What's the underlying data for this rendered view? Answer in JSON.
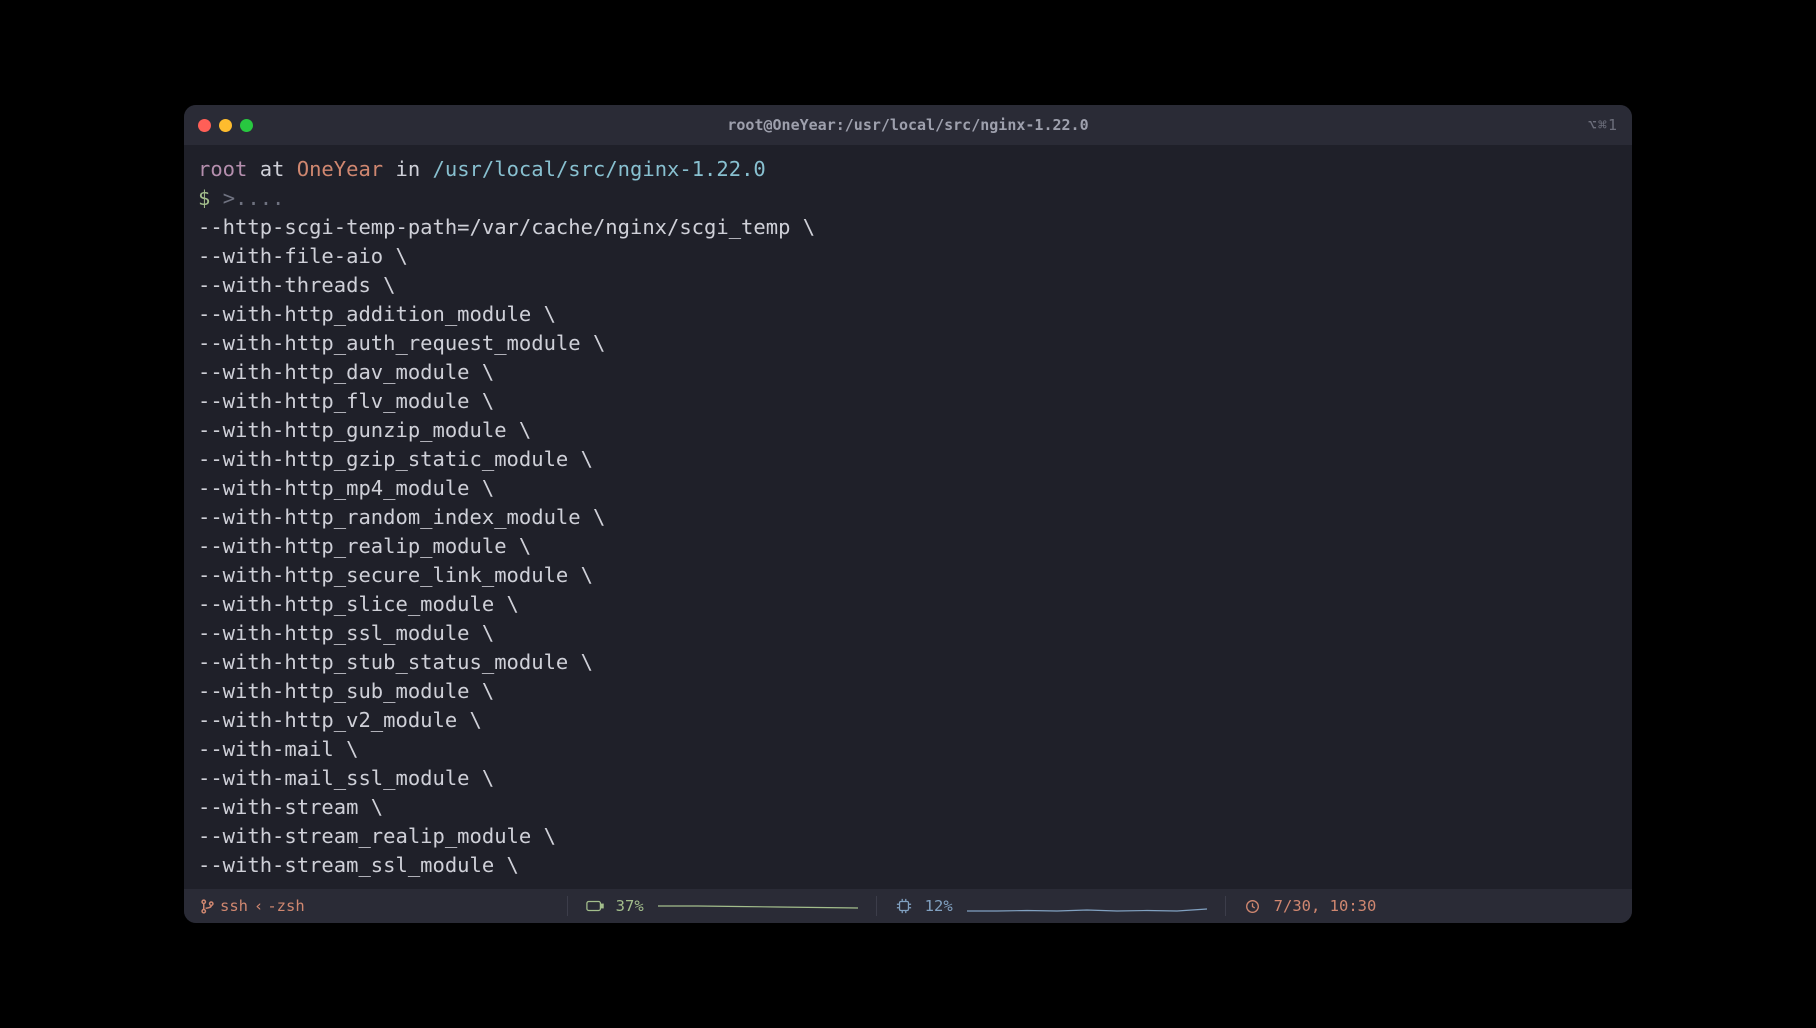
{
  "title": "root@OneYear:/usr/local/src/nginx-1.22.0",
  "shortcut": "⌥⌘1",
  "prompt": {
    "user": "root",
    "at": "at",
    "host": "OneYear",
    "in": "in",
    "path": "/usr/local/src/nginx-1.22.0",
    "symbol": "$",
    "continuation": ">....",
    "lines": [
      "--http-scgi-temp-path=/var/cache/nginx/scgi_temp \\",
      "--with-file-aio \\",
      "--with-threads \\",
      "--with-http_addition_module \\",
      "--with-http_auth_request_module \\",
      "--with-http_dav_module \\",
      "--with-http_flv_module \\",
      "--with-http_gunzip_module \\",
      "--with-http_gzip_static_module \\",
      "--with-http_mp4_module \\",
      "--with-http_random_index_module \\",
      "--with-http_realip_module \\",
      "--with-http_secure_link_module \\",
      "--with-http_slice_module \\",
      "--with-http_ssl_module \\",
      "--with-http_stub_status_module \\",
      "--with-http_sub_module \\",
      "--with-http_v2_module \\",
      "--with-mail \\",
      "--with-mail_ssl_module \\",
      "--with-stream \\",
      "--with-stream_realip_module \\",
      "--with-stream_ssl_module \\"
    ]
  },
  "status": {
    "branch": "ssh",
    "shell": "-zsh",
    "battery": "37%",
    "cpu": "12%",
    "datetime": "7/30, 10:30"
  }
}
